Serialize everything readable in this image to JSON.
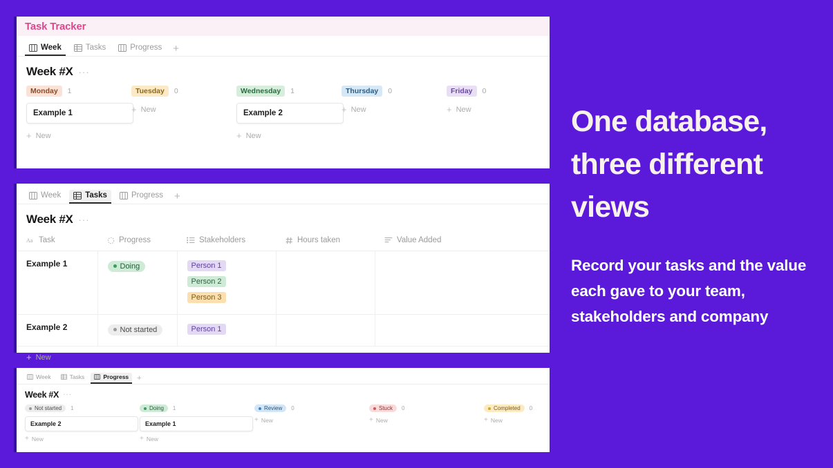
{
  "background_color": "#5B1AD9",
  "panel_accent_color": "#3A0CA8",
  "panel_week": {
    "header_title": "Task Tracker",
    "header_title_color": "#D94A8C",
    "header_bg": "#FBF0F6",
    "tabs": [
      {
        "label": "Week",
        "icon": "board-view-icon",
        "active": true
      },
      {
        "label": "Tasks",
        "icon": "table-view-icon",
        "active": false
      },
      {
        "label": "Progress",
        "icon": "board-view-icon",
        "active": false
      }
    ],
    "add_tab_label": "+",
    "view_title": "Week #X",
    "view_menu_label": "···",
    "columns": [
      {
        "name": "Monday",
        "count": "1",
        "bg": "#FAE3D6",
        "fg": "#8A4B2A",
        "cards": [
          "Example 1"
        ],
        "new_label": "New"
      },
      {
        "name": "Tuesday",
        "count": "0",
        "bg": "#FCE9C6",
        "fg": "#8A6A22",
        "cards": [],
        "new_label": "New"
      },
      {
        "name": "Wednesday",
        "count": "1",
        "bg": "#D7EEDC",
        "fg": "#2C6B42",
        "cards": [
          "Example 2"
        ],
        "new_label": "New"
      },
      {
        "name": "Thursday",
        "count": "0",
        "bg": "#D6E8F5",
        "fg": "#2F5E82",
        "cards": [],
        "new_label": "New"
      },
      {
        "name": "Friday",
        "count": "0",
        "bg": "#E9DFF5",
        "fg": "#6A4A9E",
        "cards": [],
        "new_label": "New"
      }
    ]
  },
  "panel_tasks": {
    "tabs": [
      {
        "label": "Week",
        "icon": "board-view-icon",
        "active": false
      },
      {
        "label": "Tasks",
        "icon": "table-view-icon",
        "active": true
      },
      {
        "label": "Progress",
        "icon": "board-view-icon",
        "active": false
      }
    ],
    "add_tab_label": "+",
    "view_title": "Week #X",
    "view_menu_label": "···",
    "headers": [
      {
        "label": "Task",
        "icon": "title-text-icon"
      },
      {
        "label": "Progress",
        "icon": "status-select-icon"
      },
      {
        "label": "Stakeholders",
        "icon": "multi-select-icon"
      },
      {
        "label": "Hours taken",
        "icon": "number-hash-icon"
      },
      {
        "label": "Value Added",
        "icon": "text-lines-icon"
      }
    ],
    "rows": [
      {
        "task": "Example 1",
        "progress": {
          "label": "Doing",
          "bg": "#CDEBD6",
          "fg": "#245C36",
          "dot": "#3E9B5C"
        },
        "stakeholders": [
          {
            "label": "Person 1",
            "bg": "#E4D9F5",
            "fg": "#5D3FA0"
          },
          {
            "label": "Person 2",
            "bg": "#CFEBD8",
            "fg": "#2B6340"
          },
          {
            "label": "Person 3",
            "bg": "#FBDFAE",
            "fg": "#7E5A17"
          }
        ],
        "hours_taken": "",
        "value_added": ""
      },
      {
        "task": "Example 2",
        "progress": {
          "label": "Not started",
          "bg": "#EDEDED",
          "fg": "#4A4A4A",
          "dot": "#9A9A9A"
        },
        "stakeholders": [
          {
            "label": "Person 1",
            "bg": "#E4D9F5",
            "fg": "#5D3FA0"
          }
        ],
        "hours_taken": "",
        "value_added": ""
      }
    ],
    "new_row_label": "New"
  },
  "panel_progress": {
    "tabs": [
      {
        "label": "Week",
        "icon": "board-view-icon",
        "active": false
      },
      {
        "label": "Tasks",
        "icon": "table-view-icon",
        "active": false
      },
      {
        "label": "Progress",
        "icon": "board-view-icon",
        "active": true
      }
    ],
    "add_tab_label": "+",
    "view_title": "Week #X",
    "view_menu_label": "···",
    "columns": [
      {
        "name": "Not started",
        "count": "1",
        "bg": "#EDEDED",
        "fg": "#4A4A4A",
        "dot": "#9A9A9A",
        "cards": [
          "Example 2"
        ],
        "new_label": "New"
      },
      {
        "name": "Doing",
        "count": "1",
        "bg": "#CDEBD6",
        "fg": "#245C36",
        "dot": "#3E9B5C",
        "cards": [
          "Example 1"
        ],
        "new_label": "New"
      },
      {
        "name": "Review",
        "count": "0",
        "bg": "#D3E6F7",
        "fg": "#27557C",
        "dot": "#3B82C4",
        "cards": [],
        "new_label": "New"
      },
      {
        "name": "Stuck",
        "count": "0",
        "bg": "#F8DCDC",
        "fg": "#8E3131",
        "dot": "#D35555",
        "cards": [],
        "new_label": "New"
      },
      {
        "name": "Completed",
        "count": "0",
        "bg": "#FBEBC2",
        "fg": "#7E5A17",
        "dot": "#E0A320",
        "cards": [],
        "new_label": "New"
      }
    ]
  },
  "marketing": {
    "headline": "One database, three different views",
    "headline_color": "#F7F2EA",
    "subcopy": "Record your tasks and the value each gave to your team, stakeholders and company",
    "subcopy_color": "#FFFFFF"
  }
}
